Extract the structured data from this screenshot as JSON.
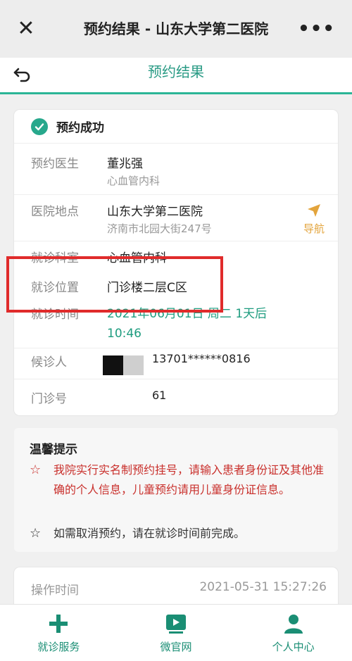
{
  "wechat": {
    "close_icon": "close-icon",
    "title": "预约结果 - 山东大学第二医院",
    "more_icon": "more-icon"
  },
  "header": {
    "back_icon": "back-icon",
    "title": "预约结果"
  },
  "result": {
    "status": "预约成功",
    "doctor_label": "预约医生",
    "doctor_name": "董兆强",
    "doctor_dept": "心血管内科",
    "hospital_label": "医院地点",
    "hospital_name": "山东大学第二医院",
    "hospital_address": "济南市北园大街247号",
    "navigate_label": "导航",
    "dept_label": "就诊科室",
    "dept_value": "心血管内科",
    "location_label": "就诊位置",
    "location_value": "门诊楼二层C区",
    "time_label": "就诊时间",
    "time_value_line1": "2021年06月01日 周二 1天后",
    "time_value_line2": "10:46",
    "patient_label": "候诊人",
    "patient_value": "13701******0816",
    "number_label": "门诊号",
    "number_value": "61"
  },
  "tips": {
    "title": "温馨提示",
    "items": [
      {
        "text": "我院实行实名制预约挂号，请输入患者身份证及其他准确的个人信息，儿童预约请用儿童身份证信息。",
        "color": "#c9302c"
      },
      {
        "text": "如需取消预约，请在就诊时间前完成。",
        "color": "#333333"
      }
    ]
  },
  "operation": {
    "label": "操作时间",
    "value": "2021-05-31 15:27:26"
  },
  "tabbar": {
    "items": [
      {
        "label": "就诊服务",
        "icon": "plus-icon"
      },
      {
        "label": "微官网",
        "icon": "video-icon"
      },
      {
        "label": "个人中心",
        "icon": "user-icon"
      }
    ]
  },
  "colors": {
    "accent": "#2bb596",
    "highlight_box": "#e02b2b",
    "navigate": "#e3a43c"
  }
}
